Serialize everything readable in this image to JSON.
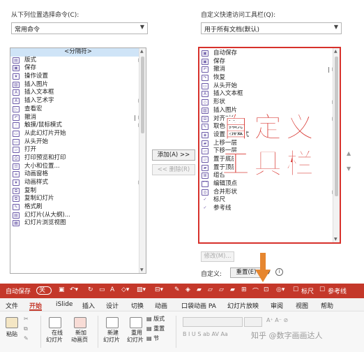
{
  "left_panel": {
    "choose_label": "从下列位置选择命令(C):",
    "choose_value": "常用命令",
    "items": [
      {
        "label": "<分隔符>"
      },
      {
        "label": "版式"
      },
      {
        "label": "保存"
      },
      {
        "label": "操作设置"
      },
      {
        "label": "插入图片"
      },
      {
        "label": "插入文本框"
      },
      {
        "label": "插入艺术字"
      },
      {
        "label": "查看宏"
      },
      {
        "label": "撤消"
      },
      {
        "label": "触摸/鼠标模式"
      },
      {
        "label": "从此幻灯片开始"
      },
      {
        "label": "从头开始"
      },
      {
        "label": "打开"
      },
      {
        "label": "打印预览和打印"
      },
      {
        "label": "大小和位置..."
      },
      {
        "label": "动画窗格"
      },
      {
        "label": "动画样式"
      },
      {
        "label": "复制"
      },
      {
        "label": "复制幻灯片"
      },
      {
        "label": "格式刷"
      },
      {
        "label": "幻灯片(从大纲)..."
      },
      {
        "label": "幻灯片浏览视图"
      }
    ]
  },
  "right_panel": {
    "customize_label": "自定义快速访问工具栏(Q):",
    "customize_value": "用于所有文档(默认)",
    "items": [
      {
        "label": "自动保存"
      },
      {
        "label": "保存"
      },
      {
        "label": "撤消"
      },
      {
        "label": "恢复"
      },
      {
        "label": "从头开始"
      },
      {
        "label": "插入文本框"
      },
      {
        "label": "形状"
      },
      {
        "label": "插入图片"
      },
      {
        "label": "对齐对象"
      },
      {
        "label": "取色器填充"
      },
      {
        "label": "设置形状格式"
      },
      {
        "label": "上移一层"
      },
      {
        "label": "下移一层"
      },
      {
        "label": "置于底层"
      },
      {
        "label": "置于顶层"
      },
      {
        "label": "组合"
      },
      {
        "label": "编辑顶点"
      },
      {
        "label": "合并形状"
      },
      {
        "label": "标尺"
      },
      {
        "label": "参考线"
      }
    ],
    "modify_label": "修改(M)...",
    "custom_label": "自定义:",
    "reset_label": "重置(E)",
    "info_icon": "info-icon"
  },
  "buttons": {
    "add": "添加(A) >>",
    "remove": "<< 删除(R)"
  },
  "overlay": {
    "line1": "自定义",
    "line2": "工具栏"
  },
  "qat": {
    "autosave": "自动保存",
    "toggle": "关",
    "ruler": "标尺",
    "guides": "参考线",
    "accent": "#c4382a"
  },
  "tabs": [
    "文件",
    "开始",
    "iSlide",
    "插入",
    "设计",
    "切换",
    "动画",
    "口袋动画 PA",
    "幻灯片放映",
    "审阅",
    "视图",
    "帮助"
  ],
  "ribbon": {
    "paste": "粘贴",
    "online_slides_1": "在线",
    "online_slides_2": "幻灯片",
    "new_chapter_1": "新加",
    "new_chapter_2": "动画页",
    "new_slide_1": "新建",
    "new_slide_2": "幻灯片",
    "reuse_1": "重用",
    "reuse_2": "幻灯片",
    "layout": "版式",
    "reset": "重置",
    "section": "节"
  },
  "watermark": "知乎 @数字画画达人"
}
